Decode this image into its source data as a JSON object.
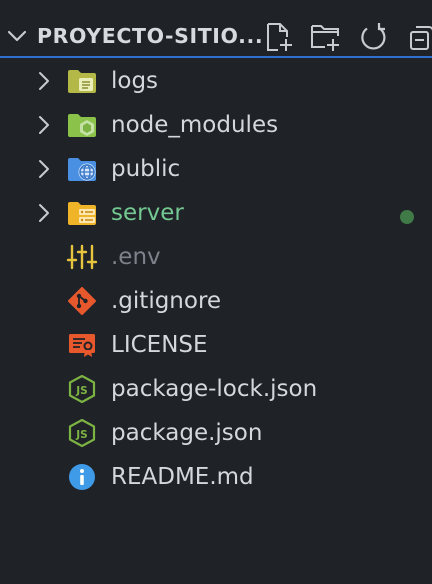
{
  "explorer": {
    "section_title": "PROYECTO-SITIO...",
    "actions": [
      {
        "name": "new-file-icon",
        "label": "New File"
      },
      {
        "name": "new-folder-icon",
        "label": "New Folder"
      },
      {
        "name": "refresh-icon",
        "label": "Refresh Explorer"
      },
      {
        "name": "collapse-all-icon",
        "label": "Collapse Folders"
      }
    ],
    "items": [
      {
        "label": "logs",
        "kind": "folder",
        "icon": "folder-logs-icon"
      },
      {
        "label": "node_modules",
        "kind": "folder",
        "icon": "folder-node-icon"
      },
      {
        "label": "public",
        "kind": "folder",
        "icon": "folder-public-icon"
      },
      {
        "label": "server",
        "kind": "folder",
        "icon": "folder-server-icon",
        "status": "modified"
      },
      {
        "label": ".env",
        "kind": "file",
        "icon": "env-tune-icon",
        "status": "ignored"
      },
      {
        "label": ".gitignore",
        "kind": "file",
        "icon": "git-icon"
      },
      {
        "label": "LICENSE",
        "kind": "file",
        "icon": "license-certificate-icon"
      },
      {
        "label": "package-lock.json",
        "kind": "file",
        "icon": "nodejs-icon"
      },
      {
        "label": "package.json",
        "kind": "file",
        "icon": "nodejs-icon"
      },
      {
        "label": "README.md",
        "kind": "file",
        "icon": "info-icon"
      }
    ]
  },
  "colors": {
    "background": "#1f2227",
    "focus_border": "#2f6fd0",
    "text": "#d4d7dc",
    "modified_text": "#73c991",
    "ignored_text": "#7d828b",
    "modified_dot": "#3f7a47",
    "folder_logs": "#b3b847",
    "folder_node": "#8bc34a",
    "folder_public": "#4a90e2",
    "folder_server": "#f0b429",
    "env_icon": "#e7c43d",
    "git_icon": "#e8582d",
    "license_icon": "#e8582d",
    "nodejs_icon": "#7cb342",
    "info_icon": "#3f9be8"
  }
}
